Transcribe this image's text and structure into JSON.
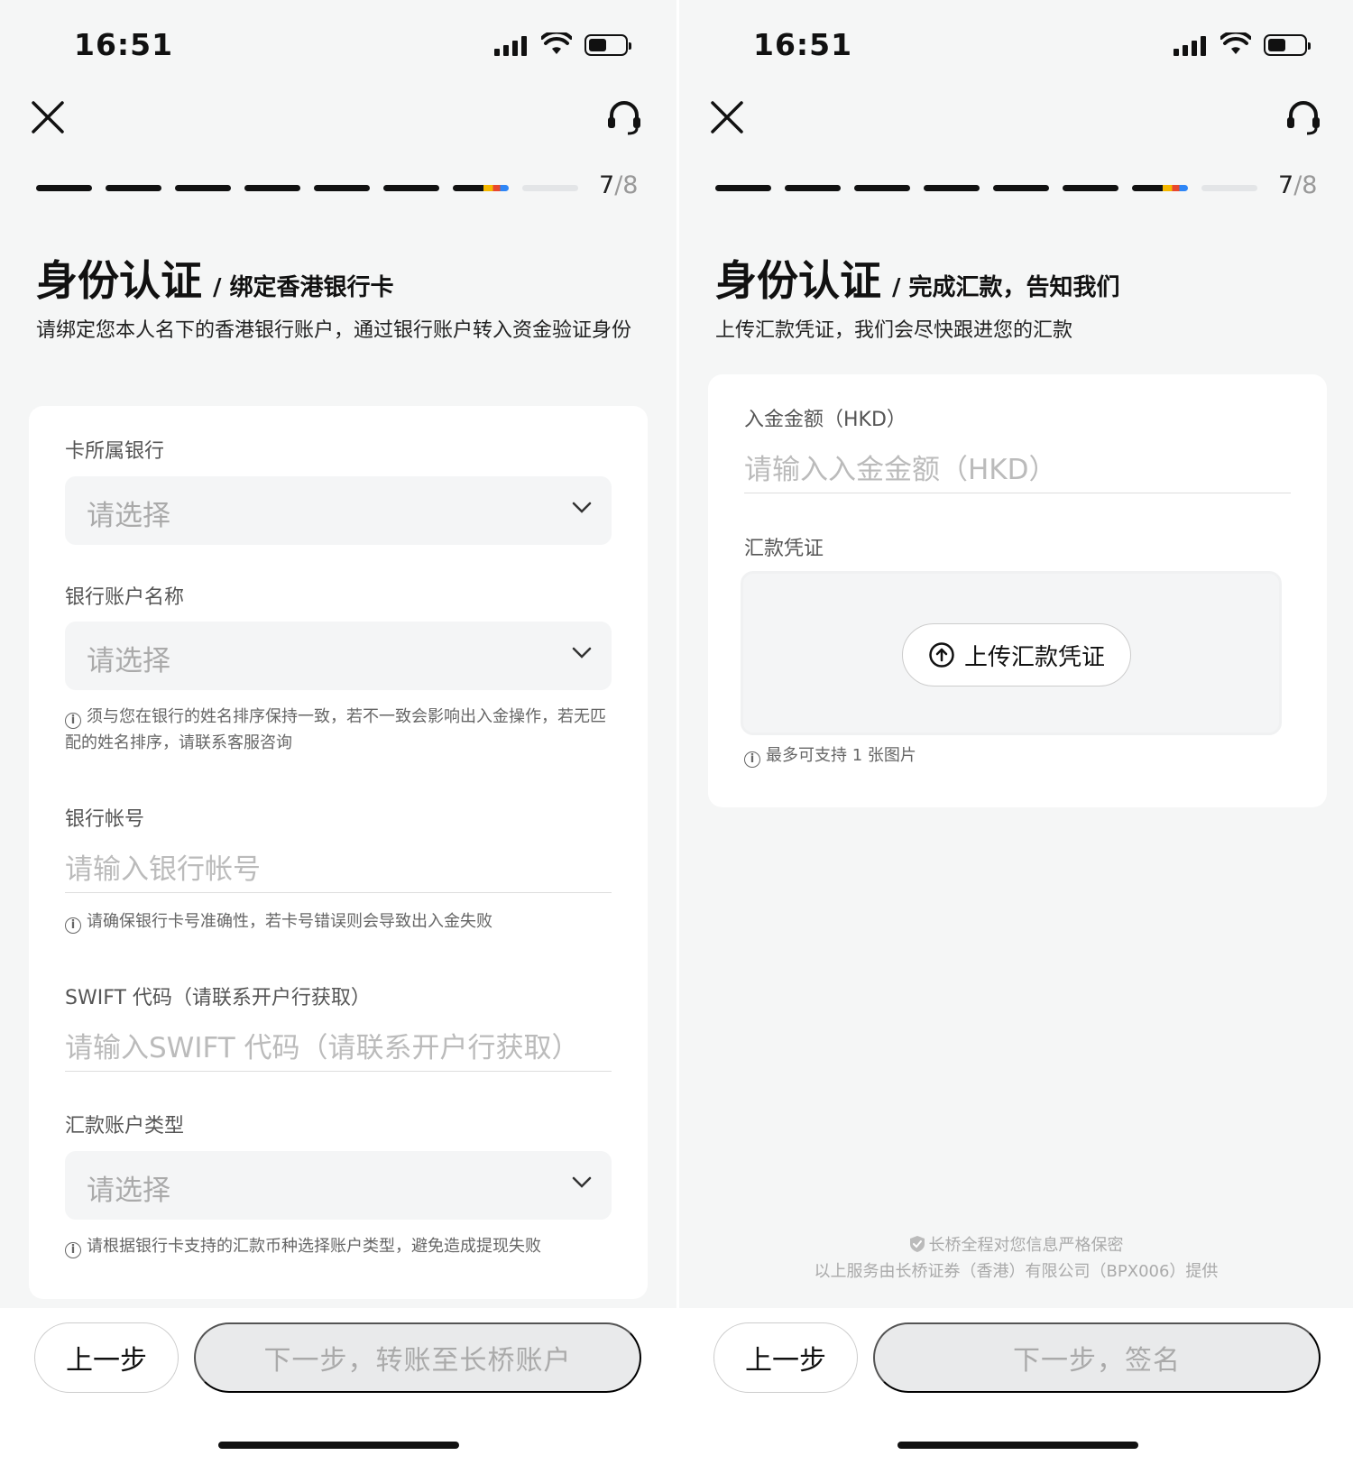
{
  "status": {
    "time": "16:51"
  },
  "left": {
    "progress_current": "7",
    "progress_total": "/8",
    "title": "身份认证",
    "subtitle": "/ 绑定香港银行卡",
    "description": "请绑定您本人名下的香港银行账户，通过银行账户转入资金验证身份",
    "fields": {
      "bank_label": "卡所属银行",
      "bank_placeholder": "请选择",
      "account_name_label": "银行账户名称",
      "account_name_placeholder": "请选择",
      "account_name_hint": "须与您在银行的姓名排序保持一致，若不一致会影响出入金操作，若无匹配的姓名排序，请联系客服咨询",
      "account_no_label": "银行帐号",
      "account_no_placeholder": "请输入银行帐号",
      "account_no_hint": "请确保银行卡号准确性，若卡号错误则会导致出入金失败",
      "swift_label": "SWIFT 代码（请联系开户行获取）",
      "swift_placeholder": "请输入SWIFT 代码（请联系开户行获取）",
      "type_label": "汇款账户类型",
      "type_placeholder": "请选择",
      "type_hint": "请根据银行卡支持的汇款币种选择账户类型，避免造成提现失败"
    },
    "prev_label": "上一步",
    "next_label": "下一步，转账至长桥账户"
  },
  "right": {
    "progress_current": "7",
    "progress_total": "/8",
    "title": "身份认证",
    "subtitle": "/ 完成汇款，告知我们",
    "description": "上传汇款凭证，我们会尽快跟进您的汇款",
    "fields": {
      "amount_label": "入金金额（HKD）",
      "amount_placeholder": "请输入入金金额（HKD）",
      "proof_label": "汇款凭证",
      "upload_label": "上传汇款凭证",
      "upload_hint": "最多可支持 1 张图片"
    },
    "privacy_line1": "长桥全程对您信息严格保密",
    "privacy_line2": "以上服务由长桥证券（香港）有限公司（BPX006）提供",
    "prev_label": "上一步",
    "next_label": "下一步，签名"
  },
  "icons": [
    "close-icon",
    "headset-icon",
    "chevron-down-icon",
    "info-icon",
    "upload-icon",
    "shield-icon",
    "signal-icon",
    "wifi-icon",
    "battery-icon"
  ]
}
